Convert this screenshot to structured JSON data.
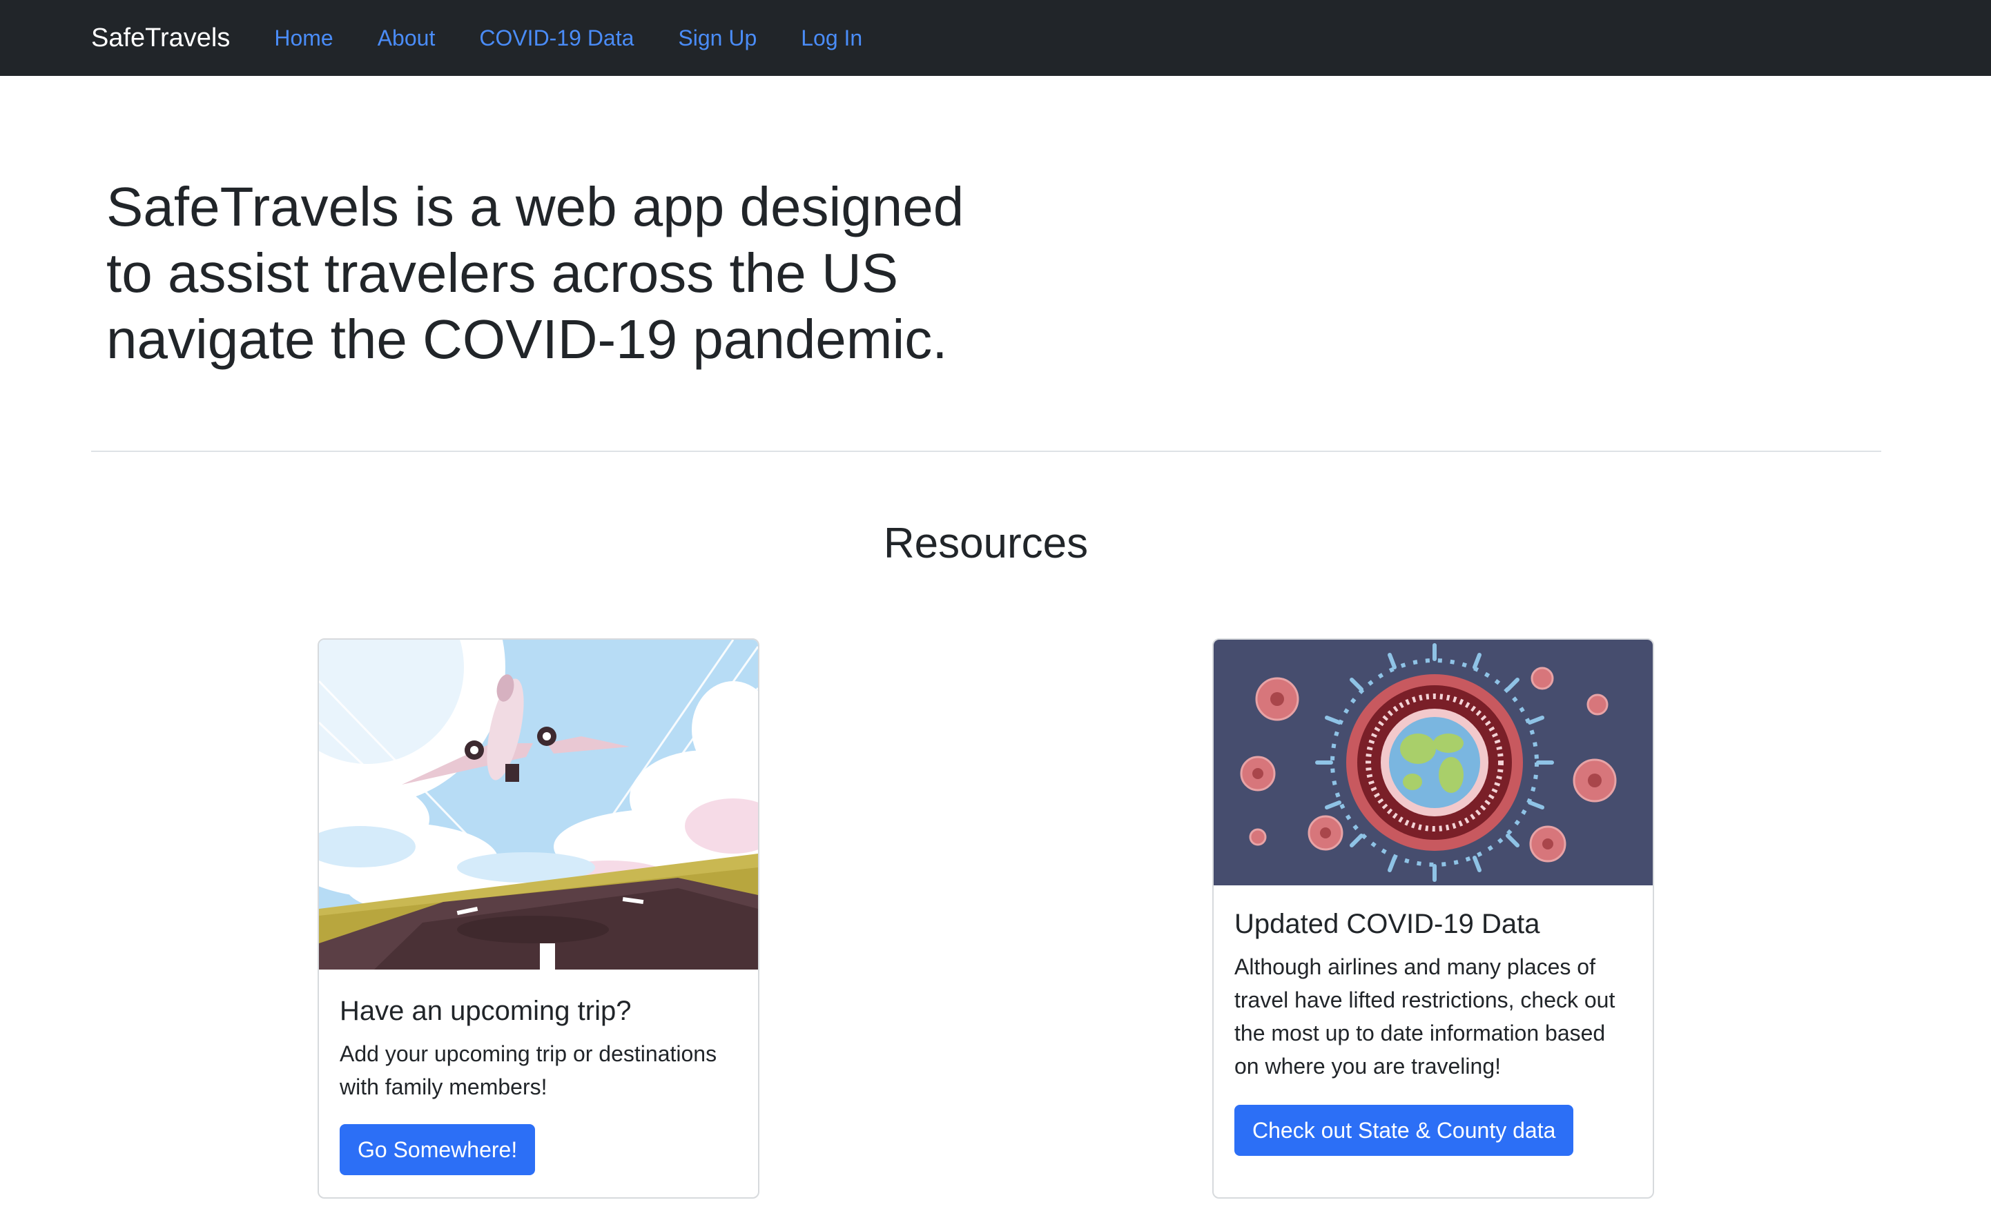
{
  "navbar": {
    "brand": "SafeTravels",
    "links": [
      {
        "label": "Home"
      },
      {
        "label": "About"
      },
      {
        "label": "COVID-19 Data"
      },
      {
        "label": "Sign Up"
      },
      {
        "label": "Log In"
      }
    ]
  },
  "hero": {
    "title": "SafeTravels is a web app designed to assist travelers across the US navigate the COVID-19 pandemic."
  },
  "resources": {
    "title": "Resources",
    "cards": [
      {
        "image": "airplane-takeoff-illustration",
        "title": "Have an upcoming trip?",
        "text": "Add your upcoming trip or destinations with family members!",
        "button": "Go Somewhere!"
      },
      {
        "image": "coronavirus-globe-illustration",
        "title": "Updated COVID-19 Data",
        "text": "Although airlines and many places of travel have lifted restrictions, check out the most up to date information based on where you are traveling!",
        "button": "Check out State & County data"
      }
    ]
  },
  "colors": {
    "navbar_bg": "#212529",
    "link": "#4a8cf7",
    "button": "#2c6ff6"
  }
}
